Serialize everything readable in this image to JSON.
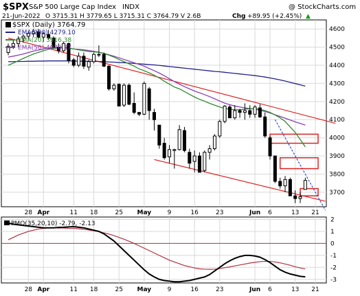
{
  "header": {
    "ticker": "$SPX",
    "name": "S&P 500 Large Cap Index",
    "exchange": "INDX",
    "watermark": "@ StockCharts.com",
    "date": "21-Jun-2022",
    "ohlc": "O 3715.31  H 3779.65  L 3715.31  C 3764.79  V 2.6B",
    "chg_label": "Chg",
    "chg_value": "+89.95 (+2.45%)",
    "chg_arrow": "▲"
  },
  "legend": {
    "price_label": "$SPX (Daily) 3764.79",
    "ema200": "EMA(200) 4279.10",
    "ema20": "EMA(20) 3916.38",
    "ema50": "EMA(50) 4070.27"
  },
  "pmo_label": "PMO(35,20,10) -2.79, -2.13",
  "colors": {
    "ema200": "#1f1f8f",
    "ema20": "#2f8a2f",
    "ema50": "#8a3fb3",
    "trend": "#e02020",
    "signal": "#b03040",
    "pmo": "#000000",
    "grid": "#d8d8d8",
    "bg": "#ffffff"
  },
  "chart_data": {
    "type": "candlestick",
    "start": "2022-03-22",
    "y_ticks": [
      3700,
      3800,
      3900,
      4000,
      4100,
      4200,
      4300,
      4400,
      4500,
      4600
    ],
    "ylim": [
      3620,
      4650
    ],
    "pmo_ticks": [
      2,
      1,
      0,
      -1,
      -2,
      -3
    ],
    "pmo_ylim": [
      -3.3,
      2.2
    ],
    "x_ticks": [
      {
        "label": "28",
        "idx": 4,
        "bold": false
      },
      {
        "label": "Apr",
        "idx": 7,
        "bold": true
      },
      {
        "label": "11",
        "idx": 13,
        "bold": false
      },
      {
        "label": "18",
        "idx": 17,
        "bold": false
      },
      {
        "label": "25",
        "idx": 22,
        "bold": false
      },
      {
        "label": "May",
        "idx": 27,
        "bold": true
      },
      {
        "label": "9",
        "idx": 32,
        "bold": false
      },
      {
        "label": "16",
        "idx": 37,
        "bold": false
      },
      {
        "label": "23",
        "idx": 42,
        "bold": false
      },
      {
        "label": "Jun",
        "idx": 49,
        "bold": true
      },
      {
        "label": "6",
        "idx": 52,
        "bold": false
      },
      {
        "label": "13",
        "idx": 57,
        "bold": false
      },
      {
        "label": "21",
        "idx": 61,
        "bold": false
      }
    ],
    "candles": [
      [
        4470,
        4520,
        4455,
        4505
      ],
      [
        4505,
        4540,
        4490,
        4520
      ],
      [
        4520,
        4560,
        4500,
        4545
      ],
      [
        4550,
        4570,
        4525,
        4560
      ],
      [
        4560,
        4590,
        4540,
        4575
      ],
      [
        4575,
        4600,
        4555,
        4585
      ],
      [
        4585,
        4600,
        4540,
        4555
      ],
      [
        4555,
        4585,
        4530,
        4575
      ],
      [
        4570,
        4595,
        4540,
        4550
      ],
      [
        4550,
        4560,
        4490,
        4500
      ],
      [
        4500,
        4520,
        4465,
        4480
      ],
      [
        4480,
        4530,
        4470,
        4520
      ],
      [
        4520,
        4525,
        4410,
        4425
      ],
      [
        4430,
        4440,
        4390,
        4400
      ],
      [
        4400,
        4470,
        4390,
        4450
      ],
      [
        4450,
        4470,
        4380,
        4395
      ],
      [
        4390,
        4430,
        4370,
        4420
      ],
      [
        4420,
        4470,
        4410,
        4460
      ],
      [
        4460,
        4510,
        4445,
        4460
      ],
      [
        4460,
        4470,
        4390,
        4395
      ],
      [
        4395,
        4400,
        4260,
        4270
      ],
      [
        4270,
        4300,
        4260,
        4290
      ],
      [
        4295,
        4300,
        4180,
        4175
      ],
      [
        4180,
        4300,
        4170,
        4290
      ],
      [
        4290,
        4300,
        4180,
        4185
      ],
      [
        4190,
        4250,
        4130,
        4140
      ],
      [
        4140,
        4140,
        4120,
        4130
      ],
      [
        4130,
        4310,
        4125,
        4300
      ],
      [
        4270,
        4280,
        4100,
        4150
      ],
      [
        4140,
        4160,
        4040,
        4100
      ],
      [
        4070,
        4070,
        3940,
        3960
      ],
      [
        3970,
        4000,
        3880,
        3890
      ],
      [
        3895,
        3960,
        3860,
        3935
      ],
      [
        3930,
        3940,
        3830,
        3935
      ],
      [
        3935,
        4070,
        3930,
        4045
      ],
      [
        4040,
        4060,
        3920,
        3930
      ],
      [
        3920,
        3940,
        3830,
        3860
      ],
      [
        3870,
        3930,
        3810,
        3900
      ],
      [
        3900,
        3920,
        3810,
        3810
      ],
      [
        3820,
        3930,
        3810,
        3920
      ],
      [
        3920,
        3960,
        3880,
        3940
      ],
      [
        3940,
        4020,
        3930,
        4010
      ],
      [
        4010,
        4100,
        4000,
        4090
      ],
      [
        4090,
        4180,
        4080,
        4175
      ],
      [
        4170,
        4180,
        4110,
        4110
      ],
      [
        4110,
        4180,
        4100,
        4150
      ],
      [
        4150,
        4160,
        4110,
        4140
      ],
      [
        4140,
        4190,
        4100,
        4150
      ],
      [
        4150,
        4180,
        4110,
        4130
      ],
      [
        4130,
        4180,
        4110,
        4170
      ],
      [
        4165,
        4185,
        4110,
        4115
      ],
      [
        4115,
        4140,
        4000,
        4010
      ],
      [
        4000,
        4010,
        3880,
        3900
      ],
      [
        3900,
        3900,
        3750,
        3760
      ],
      [
        3760,
        3780,
        3720,
        3735
      ],
      [
        3735,
        3790,
        3700,
        3770
      ],
      [
        3770,
        3780,
        3680,
        3680
      ],
      [
        3680,
        3710,
        3640,
        3665
      ],
      [
        3665,
        3700,
        3640,
        3675
      ],
      [
        3715,
        3780,
        3715,
        3765
      ]
    ],
    "ema200": [
      4420,
      4420,
      4421,
      4421,
      4422,
      4422,
      4423,
      4423,
      4424,
      4424,
      4424,
      4424,
      4424,
      4423,
      4423,
      4422,
      4422,
      4421,
      4421,
      4420,
      4418,
      4417,
      4415,
      4414,
      4412,
      4410,
      4408,
      4406,
      4404,
      4402,
      4399,
      4396,
      4393,
      4390,
      4387,
      4384,
      4381,
      4378,
      4375,
      4372,
      4369,
      4366,
      4364,
      4361,
      4358,
      4355,
      4352,
      4349,
      4346,
      4343,
      4339,
      4335,
      4330,
      4325,
      4319,
      4313,
      4306,
      4299,
      4292,
      4285
    ],
    "ema20": [
      4400,
      4412,
      4425,
      4438,
      4450,
      4462,
      4471,
      4480,
      4488,
      4494,
      4497,
      4499,
      4494,
      4490,
      4485,
      4480,
      4476,
      4474,
      4471,
      4465,
      4456,
      4445,
      4432,
      4420,
      4408,
      4395,
      4380,
      4370,
      4358,
      4345,
      4330,
      4312,
      4296,
      4280,
      4270,
      4255,
      4240,
      4225,
      4212,
      4202,
      4190,
      4180,
      4170,
      4162,
      4158,
      4155,
      4155,
      4158,
      4160,
      4160,
      4157,
      4150,
      4140,
      4126,
      4110,
      4090,
      4060,
      4030,
      3990,
      3950
    ],
    "ema50": [
      4445,
      4450,
      4456,
      4462,
      4470,
      4478,
      4484,
      4490,
      4495,
      4497,
      4497,
      4497,
      4493,
      4490,
      4488,
      4485,
      4481,
      4477,
      4472,
      4466,
      4458,
      4450,
      4441,
      4432,
      4423,
      4414,
      4405,
      4395,
      4382,
      4370,
      4357,
      4342,
      4326,
      4310,
      4296,
      4282,
      4270,
      4258,
      4248,
      4238,
      4227,
      4215,
      4203,
      4191,
      4183,
      4175,
      4170,
      4165,
      4161,
      4158,
      4152,
      4145,
      4137,
      4127,
      4118,
      4108,
      4098,
      4088,
      4079,
      4070
    ],
    "pmo": [
      1.7,
      1.6,
      1.55,
      1.5,
      1.45,
      1.4,
      1.35,
      1.3,
      1.3,
      1.3,
      1.33,
      1.35,
      1.38,
      1.4,
      1.35,
      1.3,
      1.2,
      1.1,
      1.0,
      0.8,
      0.5,
      0.2,
      -0.2,
      -0.6,
      -1.0,
      -1.4,
      -1.8,
      -2.2,
      -2.55,
      -2.8,
      -3.0,
      -3.1,
      -3.15,
      -3.2,
      -3.2,
      -3.15,
      -3.1,
      -3.0,
      -2.9,
      -2.8,
      -2.6,
      -2.3,
      -2.0,
      -1.7,
      -1.45,
      -1.25,
      -1.1,
      -1.0,
      -1.0,
      -1.05,
      -1.15,
      -1.35,
      -1.6,
      -1.9,
      -2.2,
      -2.4,
      -2.55,
      -2.65,
      -2.75,
      -2.79
    ],
    "pmo_signal": [
      0.3,
      0.5,
      0.7,
      0.85,
      1.0,
      1.1,
      1.2,
      1.25,
      1.3,
      1.3,
      1.28,
      1.28,
      1.26,
      1.25,
      1.22,
      1.18,
      1.12,
      1.05,
      0.97,
      0.88,
      0.78,
      0.65,
      0.5,
      0.35,
      0.18,
      0.0,
      -0.2,
      -0.4,
      -0.6,
      -0.8,
      -1.0,
      -1.2,
      -1.4,
      -1.55,
      -1.7,
      -1.85,
      -1.95,
      -2.05,
      -2.12,
      -2.15,
      -2.16,
      -2.15,
      -2.1,
      -2.03,
      -1.96,
      -1.88,
      -1.8,
      -1.72,
      -1.64,
      -1.58,
      -1.52,
      -1.5,
      -1.5,
      -1.55,
      -1.62,
      -1.72,
      -1.82,
      -1.95,
      -2.05,
      -2.13
    ],
    "pmo_zero_line": 0,
    "trendlines": [
      {
        "from": [
          0,
          4550
        ],
        "to": [
          65,
          4080
        ]
      },
      {
        "from": [
          29,
          3880
        ],
        "to": [
          63,
          3650
        ]
      },
      {
        "from": [
          53,
          4100
        ],
        "to": [
          63,
          3600
        ]
      }
    ],
    "gap_boxes": [
      {
        "from": 52,
        "to": 61,
        "y0": 3970,
        "y1": 4020
      },
      {
        "from": 54,
        "to": 61,
        "y0": 3830,
        "y1": 3890
      },
      {
        "from": 58,
        "to": 61,
        "y0": 3680,
        "y1": 3720
      }
    ]
  }
}
